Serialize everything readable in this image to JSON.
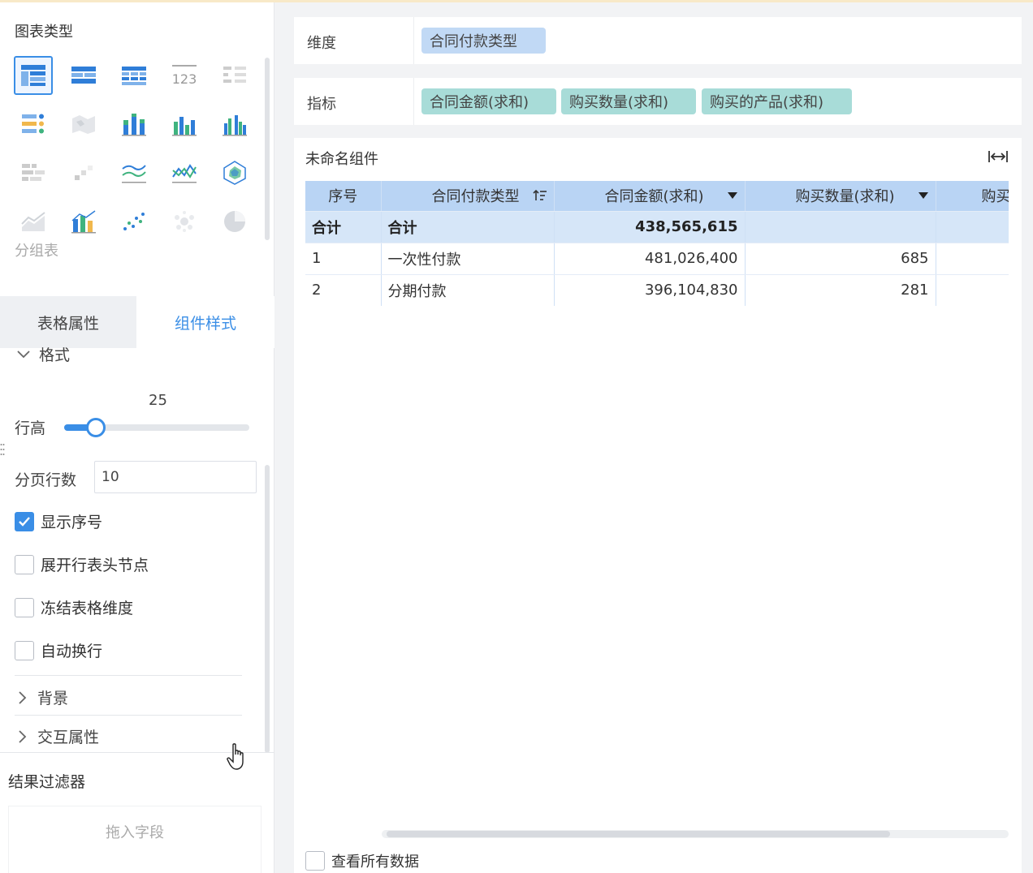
{
  "left_panel": {
    "chart_type_title": "图表类型",
    "group_label": "分组表",
    "tabs": [
      "表格属性",
      "组件样式"
    ],
    "format_section": "格式",
    "row_height": {
      "label": "行高",
      "value": "25",
      "level": 0.17
    },
    "page_rows": {
      "label": "分页行数",
      "value": "10"
    },
    "options": [
      {
        "label": "显示序号",
        "checked": true
      },
      {
        "label": "展开行表头节点",
        "checked": false
      },
      {
        "label": "冻结表格维度",
        "checked": false
      },
      {
        "label": "自动换行",
        "checked": false
      }
    ],
    "collapsed_sections": [
      "背景",
      "交互属性"
    ],
    "result_filter": {
      "title": "结果过滤器",
      "placeholder": "拖入字段"
    }
  },
  "fields": {
    "dimension": {
      "label": "维度",
      "items": [
        "合同付款类型"
      ]
    },
    "measure": {
      "label": "指标",
      "items": [
        "合同金额(求和)",
        "购买数量(求和)",
        "购买的产品(求和)"
      ]
    }
  },
  "widget": {
    "title": "未命名组件",
    "table": {
      "headers": [
        "序号",
        "合同付款类型",
        "合同金额(求和)",
        "购买数量(求和)",
        "购买"
      ],
      "total_row": [
        "合计",
        "合计",
        "438,565,615",
        "",
        ""
      ],
      "rows": [
        [
          "1",
          "一次性付款",
          "481,026,400",
          "685",
          ""
        ],
        [
          "2",
          "分期付款",
          "396,104,830",
          "281",
          ""
        ]
      ]
    },
    "view_all_label": "查看所有数据"
  },
  "colors": {
    "accent": "#3a8ee6",
    "dimension_pill": "#c1d9f5",
    "measure_pill": "#a8dcd8",
    "header_bg": "#b9d4f4"
  }
}
